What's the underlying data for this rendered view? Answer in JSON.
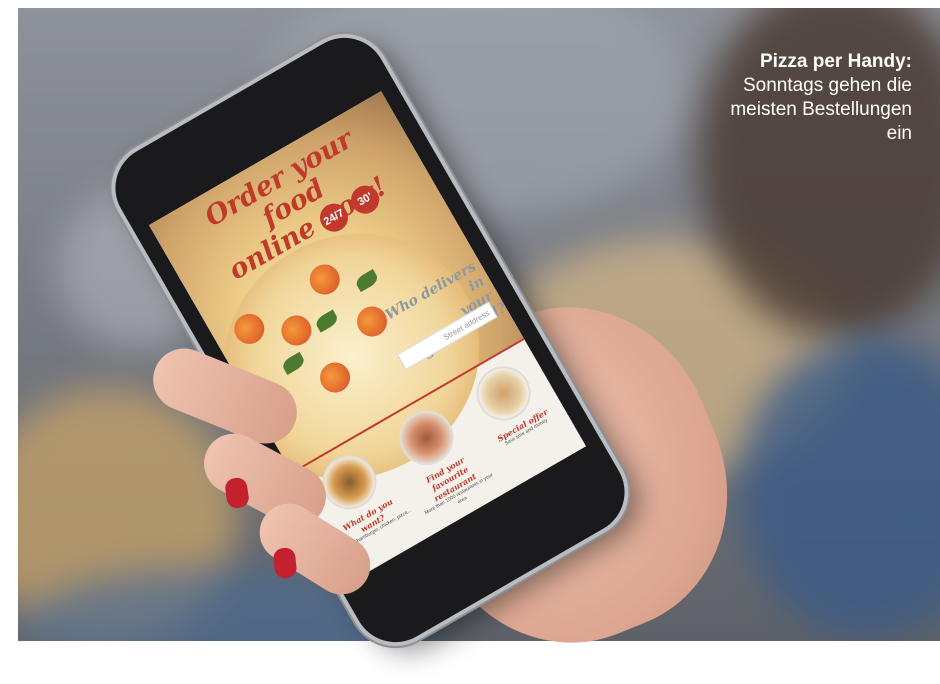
{
  "caption": {
    "bold": "Pizza per Handy:",
    "text": "Sonntags gehen die meisten Bestellungen ein"
  },
  "app": {
    "headline_line1": "Order your food",
    "headline_line2": "online now!",
    "badge_247": "24/7",
    "badge_30": "30'",
    "who_line1": "Who delivers in",
    "who_line2": "your neighborhood?",
    "search_placeholder": "Street address",
    "cards": [
      {
        "title": "What do you want?",
        "sub": "Burger, hamburger, chicken, pizza..."
      },
      {
        "title": "Find your favourite restaurant",
        "sub": "More than 1000 restaurants in your area"
      },
      {
        "title": "Special offer",
        "sub": "Save time and money"
      }
    ]
  },
  "colors": {
    "accent": "#c0392b",
    "caption_text": "#ffffff"
  }
}
